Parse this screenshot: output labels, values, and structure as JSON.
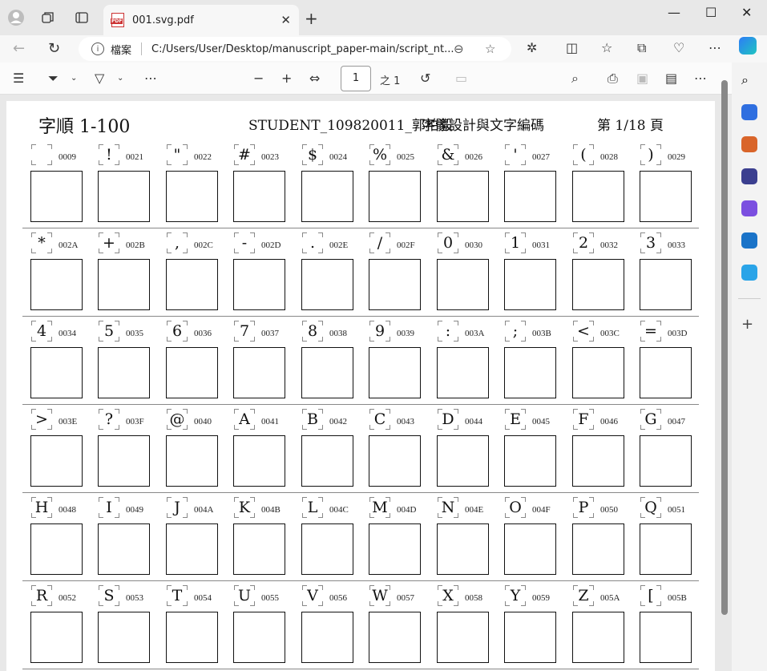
{
  "browser": {
    "tab_title": "001.svg.pdf",
    "address_label": "檔案",
    "url": "C:/Users/User/Desktop/manuscript_paper-main/script_nt..."
  },
  "pdf_toolbar": {
    "page_number": "1",
    "page_total": "之 1"
  },
  "document": {
    "title_left": "字順 1-100",
    "title_center": "STUDENT_109820011_郭柏毅",
    "title_center2": "字體設計與文字編碼",
    "title_right": "第 1/18 頁",
    "rows": [
      [
        {
          "g": "",
          "c": "0009"
        },
        {
          "g": "!",
          "c": "0021"
        },
        {
          "g": "\"",
          "c": "0022"
        },
        {
          "g": "#",
          "c": "0023"
        },
        {
          "g": "$",
          "c": "0024"
        },
        {
          "g": "%",
          "c": "0025"
        },
        {
          "g": "&",
          "c": "0026"
        },
        {
          "g": "'",
          "c": "0027"
        },
        {
          "g": "(",
          "c": "0028"
        },
        {
          "g": ")",
          "c": "0029"
        }
      ],
      [
        {
          "g": "*",
          "c": "002A"
        },
        {
          "g": "+",
          "c": "002B"
        },
        {
          "g": ",",
          "c": "002C"
        },
        {
          "g": "-",
          "c": "002D"
        },
        {
          "g": ".",
          "c": "002E"
        },
        {
          "g": "/",
          "c": "002F"
        },
        {
          "g": "0",
          "c": "0030"
        },
        {
          "g": "1",
          "c": "0031"
        },
        {
          "g": "2",
          "c": "0032"
        },
        {
          "g": "3",
          "c": "0033"
        }
      ],
      [
        {
          "g": "4",
          "c": "0034"
        },
        {
          "g": "5",
          "c": "0035"
        },
        {
          "g": "6",
          "c": "0036"
        },
        {
          "g": "7",
          "c": "0037"
        },
        {
          "g": "8",
          "c": "0038"
        },
        {
          "g": "9",
          "c": "0039"
        },
        {
          "g": ":",
          "c": "003A"
        },
        {
          "g": ";",
          "c": "003B"
        },
        {
          "g": "<",
          "c": "003C"
        },
        {
          "g": "=",
          "c": "003D"
        }
      ],
      [
        {
          "g": ">",
          "c": "003E"
        },
        {
          "g": "?",
          "c": "003F"
        },
        {
          "g": "@",
          "c": "0040"
        },
        {
          "g": "A",
          "c": "0041"
        },
        {
          "g": "B",
          "c": "0042"
        },
        {
          "g": "C",
          "c": "0043"
        },
        {
          "g": "D",
          "c": "0044"
        },
        {
          "g": "E",
          "c": "0045"
        },
        {
          "g": "F",
          "c": "0046"
        },
        {
          "g": "G",
          "c": "0047"
        }
      ],
      [
        {
          "g": "H",
          "c": "0048"
        },
        {
          "g": "I",
          "c": "0049"
        },
        {
          "g": "J",
          "c": "004A"
        },
        {
          "g": "K",
          "c": "004B"
        },
        {
          "g": "L",
          "c": "004C"
        },
        {
          "g": "M",
          "c": "004D"
        },
        {
          "g": "N",
          "c": "004E"
        },
        {
          "g": "O",
          "c": "004F"
        },
        {
          "g": "P",
          "c": "0050"
        },
        {
          "g": "Q",
          "c": "0051"
        }
      ],
      [
        {
          "g": "R",
          "c": "0052"
        },
        {
          "g": "S",
          "c": "0053"
        },
        {
          "g": "T",
          "c": "0054"
        },
        {
          "g": "U",
          "c": "0055"
        },
        {
          "g": "V",
          "c": "0056"
        },
        {
          "g": "W",
          "c": "0057"
        },
        {
          "g": "X",
          "c": "0058"
        },
        {
          "g": "Y",
          "c": "0059"
        },
        {
          "g": "Z",
          "c": "005A"
        },
        {
          "g": "[",
          "c": "005B"
        }
      ]
    ]
  }
}
